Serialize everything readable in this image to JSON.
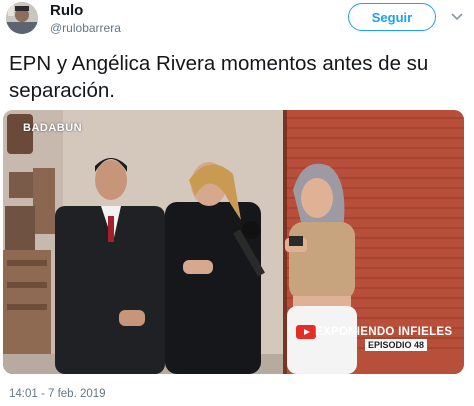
{
  "author": {
    "display_name": "Rulo",
    "handle": "@rulobarrera",
    "avatar_icon": "user-avatar"
  },
  "header": {
    "follow_label": "Seguir",
    "more_icon": "chevron-down-icon",
    "accent_color": "#1da1f2"
  },
  "tweet": {
    "text": "EPN y Angélica Rivera momentos antes de su separación.",
    "timestamp": "14:01 - 7 feb. 2019"
  },
  "media": {
    "watermark": "BADABUN",
    "show_title": "EXPONIENDO INFIELES",
    "episode": "EPISODIO 48",
    "play_icon": "youtube-play-icon"
  }
}
